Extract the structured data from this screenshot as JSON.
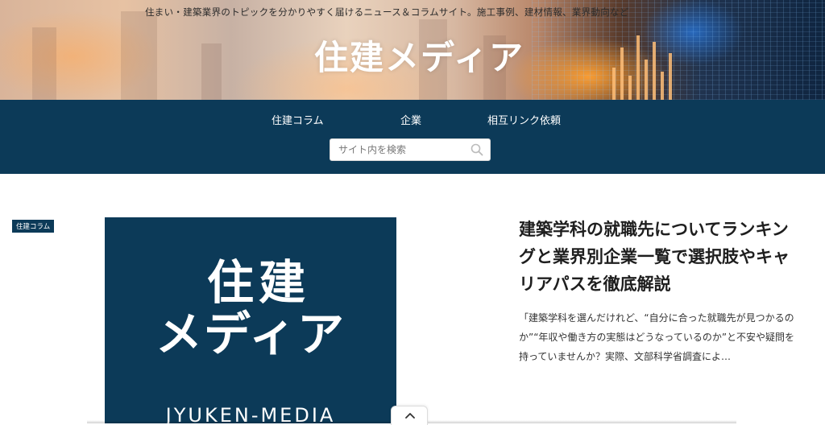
{
  "header": {
    "tagline": "住まい・建築業界のトピックを分かりやすく届けるニュース＆コラムサイト。施工事例、建材情報、業界動向など",
    "site_title": "住建メディア"
  },
  "nav": {
    "items": [
      {
        "label": "住建コラム"
      },
      {
        "label": "企業"
      },
      {
        "label": "相互リンク依頼"
      }
    ],
    "search": {
      "placeholder": "サイト内を検索"
    }
  },
  "article": {
    "category": "住建コラム",
    "thumbnail": {
      "logo_line1": "住建",
      "logo_line2": "メディア",
      "subtitle": "JYUKEN-MEDIA"
    },
    "title": "建築学科の就職先についてランキングと業界別企業一覧で選択肢やキャリアパスを徹底解説",
    "excerpt": "「建築学科を選んだけれど、“自分に合った就職先が見つかるのか”“年収や働き方の実態はどうなっているのか”と不安や疑問を持っていませんか？実際、文部科学省調査によ…"
  },
  "icons": {
    "search": "search-icon",
    "scroll_top": "chevron-up-icon"
  },
  "colors": {
    "brand_navy": "#0c3a58",
    "text_dark": "#1e1e1e"
  }
}
